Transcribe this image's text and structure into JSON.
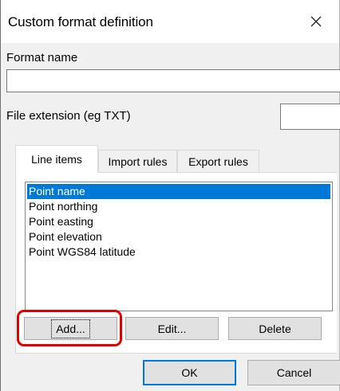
{
  "window": {
    "title": "Custom format definition",
    "close_icon": "close-icon"
  },
  "form": {
    "format_name_label": "Format name",
    "format_name_value": "",
    "file_extension_label": "File extension (eg TXT)",
    "file_extension_value": ""
  },
  "tabs": [
    {
      "label": "Line items",
      "active": true
    },
    {
      "label": "Import rules",
      "active": false
    },
    {
      "label": "Export rules",
      "active": false
    }
  ],
  "line_items": [
    {
      "label": "Point name",
      "selected": true
    },
    {
      "label": "Point northing",
      "selected": false
    },
    {
      "label": "Point easting",
      "selected": false
    },
    {
      "label": "Point elevation",
      "selected": false
    },
    {
      "label": "Point WGS84 latitude",
      "selected": false
    }
  ],
  "list_buttons": {
    "add": "Add...",
    "edit": "Edit...",
    "delete": "Delete"
  },
  "dialog_buttons": {
    "ok": "OK",
    "cancel": "Cancel"
  },
  "colors": {
    "selection": "#0078d7",
    "highlight_annotation": "#e00000"
  }
}
